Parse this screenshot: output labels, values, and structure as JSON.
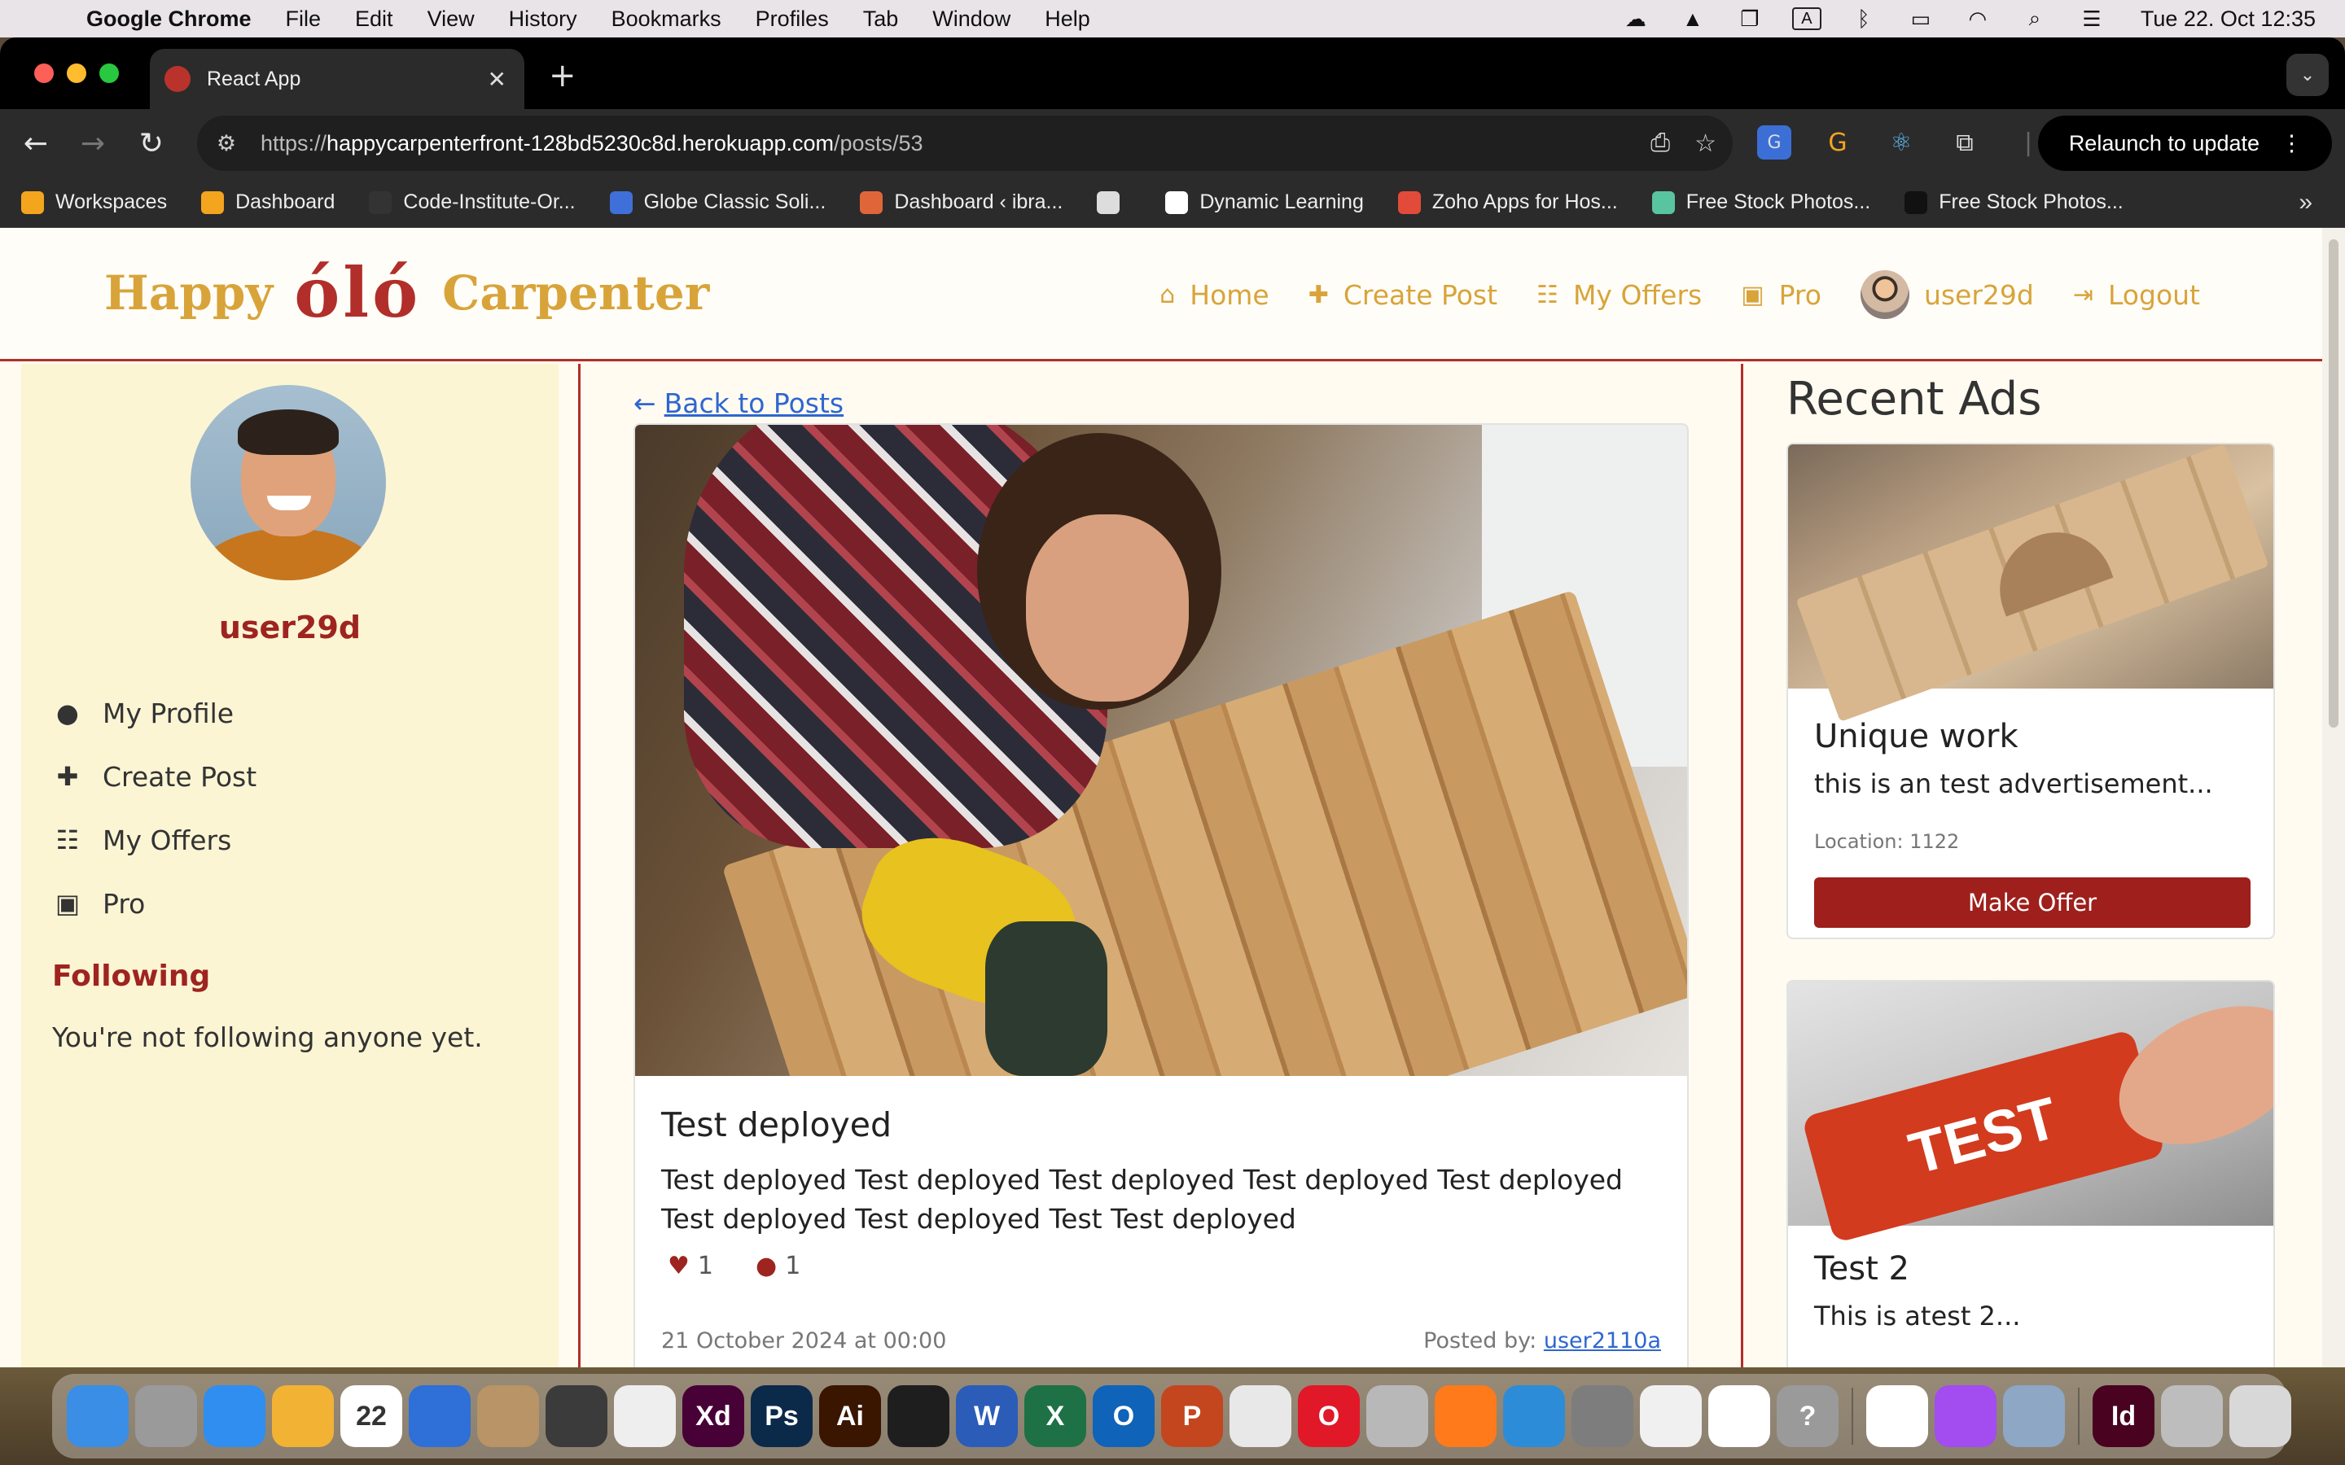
{
  "menubar": {
    "app_name": "Google Chrome",
    "items": [
      "File",
      "Edit",
      "View",
      "History",
      "Bookmarks",
      "Profiles",
      "Tab",
      "Window",
      "Help"
    ],
    "clock": "Tue 22. Oct  12:35",
    "input_indicator": "A"
  },
  "browser": {
    "tab_title": "React App",
    "url_scheme": "https://",
    "url_host": "happycarpenterfront-128bd5230c8d.herokuapp.com",
    "url_path": "/posts/53",
    "relaunch_label": "Relaunch to update",
    "bookmarks": [
      {
        "label": "Workspaces",
        "color": "#f3a51e"
      },
      {
        "label": "Dashboard",
        "color": "#f3a51e"
      },
      {
        "label": "Code-Institute-Or...",
        "color": "#333333"
      },
      {
        "label": "Globe Classic Soli...",
        "color": "#3f6fd8"
      },
      {
        "label": "Dashboard ‹ ibra...",
        "color": "#e0663a"
      },
      {
        "label": "",
        "color": "#dddddd"
      },
      {
        "label": "Dynamic Learning",
        "color": "#ffffff"
      },
      {
        "label": "Zoho Apps for Hos...",
        "color": "#e24b3a"
      },
      {
        "label": "Free Stock Photos...",
        "color": "#59c4a0"
      },
      {
        "label": "Free Stock Photos...",
        "color": "#111111"
      }
    ]
  },
  "site": {
    "logo_word1": "Happy",
    "logo_mark": "óló",
    "logo_word2": "Carpenter",
    "nav": [
      {
        "label": "Home",
        "icon": "home-icon",
        "glyph": "⌂"
      },
      {
        "label": "Create Post",
        "icon": "plus-square-icon",
        "glyph": "✚"
      },
      {
        "label": "My Offers",
        "icon": "clipboard-icon",
        "glyph": "☷"
      },
      {
        "label": "Pro",
        "icon": "briefcase-icon",
        "glyph": "▣"
      }
    ],
    "username": "user29d",
    "logout_label": "Logout"
  },
  "sidebar": {
    "username": "user29d",
    "menu": [
      {
        "label": "My Profile",
        "icon": "user-icon",
        "glyph": "●"
      },
      {
        "label": "Create Post",
        "icon": "plus-square-icon",
        "glyph": "✚"
      },
      {
        "label": "My Offers",
        "icon": "clipboard-icon",
        "glyph": "☷"
      },
      {
        "label": "Pro",
        "icon": "briefcase-icon",
        "glyph": "▣"
      }
    ],
    "following_heading": "Following",
    "following_text": "You're not following anyone yet."
  },
  "post": {
    "back_label": "Back to Posts",
    "title": "Test deployed",
    "body": "Test deployed Test deployed Test deployed Test deployed Test deployed Test deployed Test deployed Test Test deployed",
    "likes": "1",
    "comments": "1",
    "date": "21 October 2024 at 00:00",
    "posted_by_label": "Posted by:",
    "author": "user2110a"
  },
  "recent_ads": {
    "heading": "Recent Ads",
    "ads": [
      {
        "title": "Unique work",
        "text": "this is an test advertisement...",
        "location": "Location: 1122",
        "button": "Make Offer"
      },
      {
        "title": "Test 2",
        "text": "This is atest 2...",
        "image_text": "TEST"
      }
    ]
  },
  "dock": {
    "apps": [
      {
        "name": "finder-app",
        "label": "",
        "color": "#3a8ee6"
      },
      {
        "name": "launchpad-app",
        "label": "",
        "color": "#9a9a9a"
      },
      {
        "name": "safari-app",
        "label": "",
        "color": "#2f8ef0"
      },
      {
        "name": "photos-app",
        "label": "",
        "color": "#f2b233"
      },
      {
        "name": "calendar-app",
        "label": "22",
        "color": "#ffffff"
      },
      {
        "name": "thunderbird-app",
        "label": "",
        "color": "#2e6fd8"
      },
      {
        "name": "contacts-app",
        "label": "",
        "color": "#b89466"
      },
      {
        "name": "calculator-app",
        "label": "",
        "color": "#3b3b3b"
      },
      {
        "name": "textedit-app",
        "label": "",
        "color": "#eeeeee"
      },
      {
        "name": "xd-app",
        "label": "Xd",
        "color": "#470137"
      },
      {
        "name": "photoshop-app",
        "label": "Ps",
        "color": "#0b2a4a"
      },
      {
        "name": "illustrator-app",
        "label": "Ai",
        "color": "#3a1500"
      },
      {
        "name": "figma-app",
        "label": "",
        "color": "#1e1e1e"
      },
      {
        "name": "word-app",
        "label": "W",
        "color": "#2b5cb8"
      },
      {
        "name": "excel-app",
        "label": "X",
        "color": "#1e7145"
      },
      {
        "name": "outlook-app",
        "label": "O",
        "color": "#0f63b8"
      },
      {
        "name": "powerpoint-app",
        "label": "P",
        "color": "#c4461f"
      },
      {
        "name": "chrome-app",
        "label": "",
        "color": "#e8e8e8"
      },
      {
        "name": "opera-app",
        "label": "O",
        "color": "#e01828"
      },
      {
        "name": "whatsapp-app",
        "label": "",
        "color": "#b8b8b8"
      },
      {
        "name": "firefox-app",
        "label": "",
        "color": "#ff7a1a"
      },
      {
        "name": "vscode-app",
        "label": "",
        "color": "#2d8cd8"
      },
      {
        "name": "settings-app",
        "label": "",
        "color": "#7d7d7d"
      },
      {
        "name": "capcut-app",
        "label": "",
        "color": "#f0f0f0"
      },
      {
        "name": "slack-app",
        "label": "",
        "color": "#ffffff"
      },
      {
        "name": "help-app",
        "label": "?",
        "color": "#9a9a9a"
      },
      {
        "name": "freeform-app",
        "label": "",
        "color": "#ffffff"
      },
      {
        "name": "messenger-app",
        "label": "",
        "color": "#a34cf0"
      },
      {
        "name": "preview-app",
        "label": "",
        "color": "#8da7c4"
      },
      {
        "name": "indesign-app",
        "label": "Id",
        "color": "#49021f"
      },
      {
        "name": "archive-app",
        "label": "",
        "color": "#bdbdbd"
      },
      {
        "name": "trash-app",
        "label": "",
        "color": "#d8d8d8"
      }
    ]
  }
}
